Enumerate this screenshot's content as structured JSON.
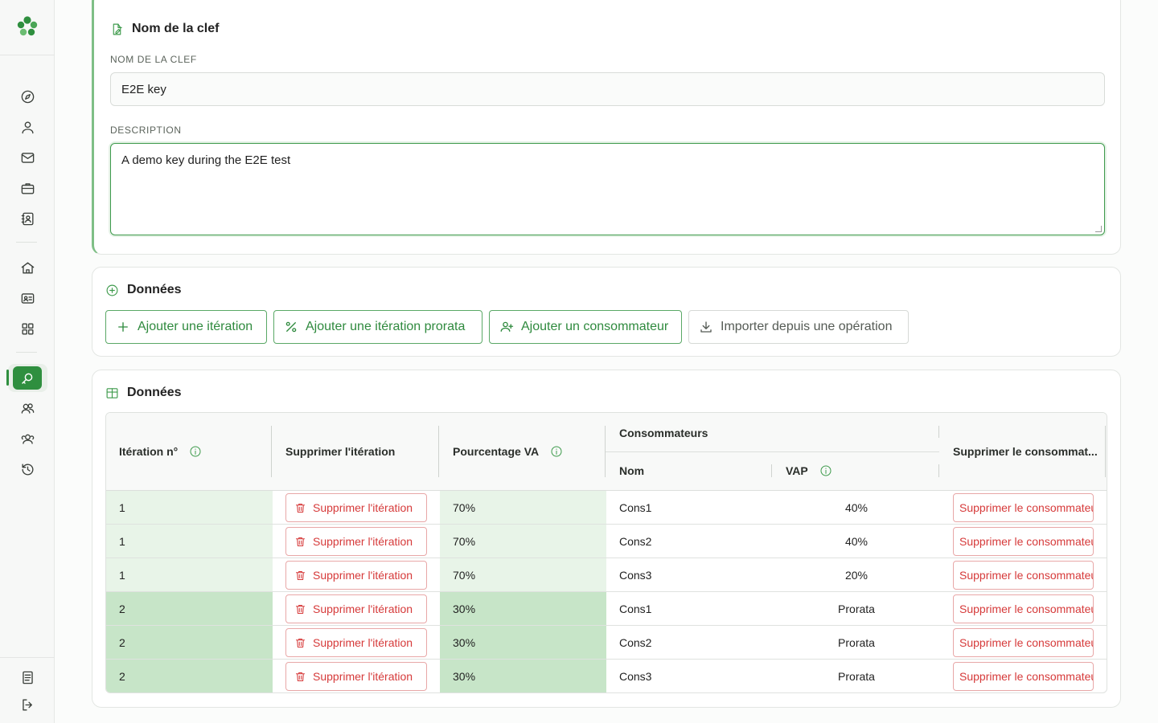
{
  "card_key": {
    "title": "Nom de la clef",
    "name_label": "NOM DE LA CLEF",
    "name_value": "E2E key",
    "description_label": "DESCRIPTION",
    "description_value": "A demo key during the E2E test"
  },
  "card_actions": {
    "title": "Données",
    "buttons": {
      "add_iteration": "Ajouter une itération",
      "add_prorata": "Ajouter une itération prorata",
      "add_consumer": "Ajouter un consommateur",
      "import": "Importer depuis une opération"
    }
  },
  "card_table": {
    "title": "Données",
    "headers": {
      "iteration": "Itération n°",
      "delete_iteration": "Supprimer l'itération",
      "percentage": "Pourcentage VA",
      "consumers": "Consommateurs",
      "name": "Nom",
      "vap": "VAP",
      "delete_consumer": "Supprimer le consommat..."
    },
    "delete_iteration_label": "Supprimer l'itération",
    "delete_consumer_label": "Supprimer le consommateur",
    "rows": [
      {
        "iteration": "1",
        "percentage": "70%",
        "name": "Cons1",
        "vap": "40%"
      },
      {
        "iteration": "1",
        "percentage": "70%",
        "name": "Cons2",
        "vap": "40%"
      },
      {
        "iteration": "1",
        "percentage": "70%",
        "name": "Cons3",
        "vap": "20%"
      },
      {
        "iteration": "2",
        "percentage": "30%",
        "name": "Cons1",
        "vap": "Prorata"
      },
      {
        "iteration": "2",
        "percentage": "30%",
        "name": "Cons2",
        "vap": "Prorata"
      },
      {
        "iteration": "2",
        "percentage": "30%",
        "name": "Cons3",
        "vap": "Prorata"
      }
    ]
  },
  "theme": {
    "accent": "#2f8f3f",
    "iteration_1_bg": "#e8f4e8",
    "iteration_2_bg": "#c7e5c8",
    "danger": "#d63a3a"
  },
  "sidebar_icons": [
    "compass-icon",
    "user-icon",
    "mail-icon",
    "briefcase-icon",
    "contact-book-icon",
    "home-icon",
    "id-card-icon",
    "grid-icon",
    "key-search-icon",
    "users-icon",
    "team-icon",
    "history-icon",
    "document-icon",
    "logout-icon"
  ]
}
